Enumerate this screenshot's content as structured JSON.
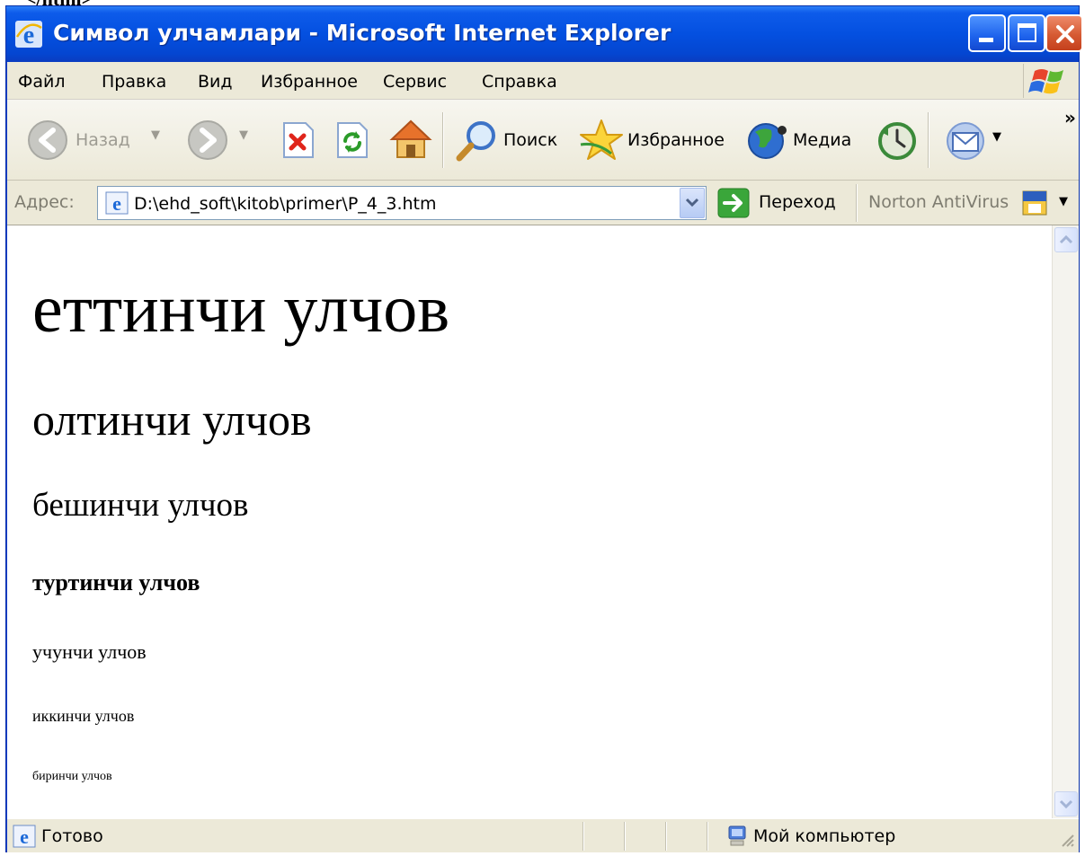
{
  "window": {
    "title": "Символ улчамлари - Microsoft Internet Explorer"
  },
  "menu": {
    "items": [
      "Файл",
      "Правка",
      "Вид",
      "Избранное",
      "Сервис",
      "Справка"
    ]
  },
  "toolbar": {
    "back_label": "Назад",
    "search_label": "Поиск",
    "favorites_label": "Избранное",
    "media_label": "Медиа",
    "chevron": "»"
  },
  "address": {
    "label": "Адрес:",
    "value": "D:\\ehd_soft\\kitob\\primer\\P_4_3.htm",
    "go_label": "Переход",
    "norton_label": "Norton AntiVirus"
  },
  "page": {
    "cropped_tag": "</html>",
    "headings": [
      "еттинчи улчов",
      "олтинчи улчов",
      "бешинчи улчов",
      "туртинчи улчов",
      "учунчи улчов",
      "иккинчи улчов",
      "биринчи улчов"
    ]
  },
  "status": {
    "text": "Готово",
    "zone": "Мой компьютер"
  },
  "colors": {
    "titlebar": "#0450e0",
    "chrome": "#ece9d8"
  }
}
